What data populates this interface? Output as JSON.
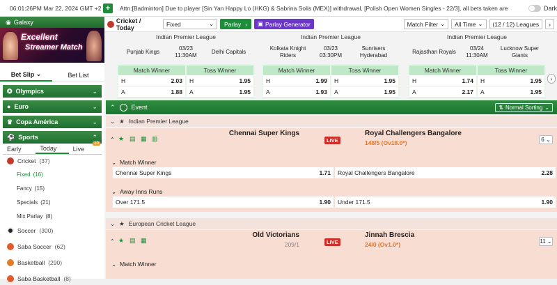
{
  "topbar": {
    "datetime": "06:01:26PM Mar 22, 2024 GMT +2",
    "plus": "+",
    "marquee": "Attn:[Badminton] Due to player [Sin Yan Happy Lo (HKG) & Sabrina Solis (MEX)] withdrawal, [Polish Open Women Singles - 22/3], all bets taken are",
    "dark_label": "Dark"
  },
  "sidebar": {
    "galaxy": "Galaxy",
    "banner_line1": "Excellent",
    "banner_line2": "Streamer Match",
    "tab_betslip": "Bet Slip",
    "tab_betlist": "Bet List",
    "categories": [
      {
        "label": "Olympics",
        "chev": "⌄"
      },
      {
        "label": "Euro",
        "chev": "⌄"
      },
      {
        "label": "Copa América",
        "chev": "⌄"
      },
      {
        "label": "Sports",
        "chev": "⌃"
      }
    ],
    "subtabs": [
      "Early",
      "Today",
      "Live"
    ],
    "live_badge": "10",
    "cricket": {
      "label": "Cricket",
      "count": "(37)"
    },
    "cricket_sub": [
      {
        "label": "Fixed",
        "count": "(16)"
      },
      {
        "label": "Fancy",
        "count": "(15)"
      },
      {
        "label": "Specials",
        "count": "(21)"
      },
      {
        "label": "Mix Parlay",
        "count": "(8)"
      }
    ],
    "sports": [
      {
        "label": "Soccer",
        "count": "(300)"
      },
      {
        "label": "Saba Soccer",
        "count": "(62)"
      },
      {
        "label": "Basketball",
        "count": "(290)"
      },
      {
        "label": "Saba Basketball",
        "count": "(8)"
      }
    ]
  },
  "toolbar": {
    "title": "Cricket / Today",
    "fixed_select": "Fixed",
    "parlay": "Parlay",
    "parlay_generator": "Parlay Generator",
    "match_filter": "Match Filter",
    "all_time": "All Time",
    "leagues": "(12 / 12) Leagues"
  },
  "cards": [
    {
      "league": "Indian Premier League",
      "home": "Punjab Kings",
      "away": "Delhi Capitals",
      "date": "03/23",
      "time": "11:30AM",
      "match_winner": "Match Winner",
      "toss_winner": "Toss Winner",
      "mw": [
        {
          "k": "H",
          "v": "2.03"
        },
        {
          "k": "A",
          "v": "1.88"
        }
      ],
      "tw": [
        {
          "k": "H",
          "v": "1.95"
        },
        {
          "k": "A",
          "v": "1.95"
        }
      ]
    },
    {
      "league": "Indian Premier League",
      "home": "Kolkata Knight Riders",
      "away": "Sunrisers Hyderabad",
      "date": "03/23",
      "time": "03:30PM",
      "match_winner": "Match Winner",
      "toss_winner": "Toss Winner",
      "mw": [
        {
          "k": "H",
          "v": "1.99"
        },
        {
          "k": "A",
          "v": "1.93"
        }
      ],
      "tw": [
        {
          "k": "H",
          "v": "1.95"
        },
        {
          "k": "A",
          "v": "1.95"
        }
      ]
    },
    {
      "league": "Indian Premier League",
      "home": "Rajasthan Royals",
      "away": "Lucknow Super Giants",
      "date": "03/24",
      "time": "11:30AM",
      "match_winner": "Match Winner",
      "toss_winner": "Toss Winner",
      "mw": [
        {
          "k": "H",
          "v": "1.74"
        },
        {
          "k": "A",
          "v": "2.17"
        }
      ],
      "tw": [
        {
          "k": "H",
          "v": "1.95"
        },
        {
          "k": "A",
          "v": "1.95"
        }
      ]
    }
  ],
  "event_bar": {
    "label": "Event",
    "sort": "Normal Sorting"
  },
  "leagues": [
    {
      "name": "Indian Premier League",
      "match": {
        "home": "Chennai Super Kings",
        "away": "Royal Challengers Bangalore",
        "home_score": "",
        "away_score": "148/5 (Ov18.0*)",
        "live": "LIVE",
        "more": "6",
        "markets": [
          {
            "title": "Match Winner",
            "left": "Chennai Super Kings",
            "left_v": "1.71",
            "right": "Royal Challengers Bangalore",
            "right_v": "2.28"
          },
          {
            "title": "Away Inns Runs",
            "left": "Over 171.5",
            "left_v": "1.90",
            "right": "Under 171.5",
            "right_v": "1.90"
          }
        ]
      }
    },
    {
      "name": "European Cricket League",
      "match": {
        "home": "Old Victorians",
        "away": "Jinnah Brescia",
        "home_score": "209/1",
        "away_score": "24/0 (Ov1.0*)",
        "live": "LIVE",
        "more": "11",
        "markets": [
          {
            "title": "Match Winner"
          }
        ]
      }
    }
  ],
  "colors": {
    "green": "#1e8c3a",
    "purple": "#6a37c9",
    "live": "#d0302a",
    "orange": "#e2762d"
  }
}
